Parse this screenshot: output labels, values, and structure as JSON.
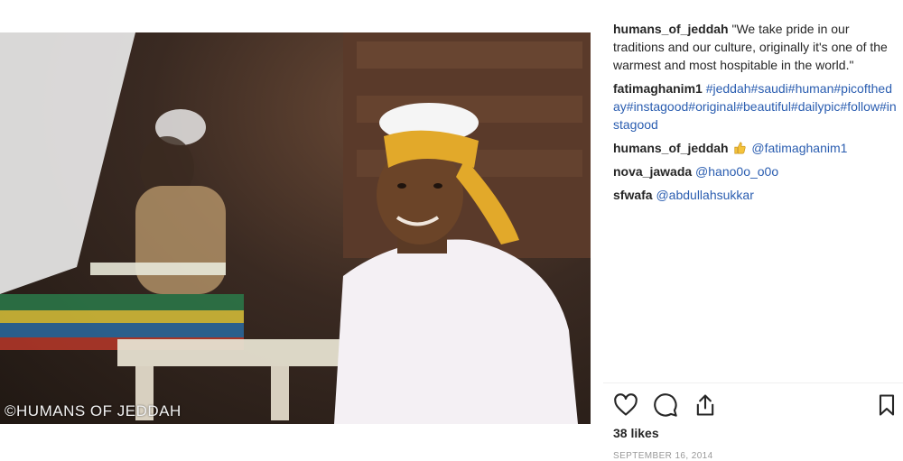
{
  "post": {
    "watermark": "©HUMANS OF JEDDAH",
    "caption": {
      "user": "humans_of_jeddah",
      "text": "\"We take pride in our traditions and our culture, originally it's one of the warmest and most hospitable in the world.\""
    },
    "comments": [
      {
        "user": "fatimaghanim1",
        "link": "#jeddah#saudi#human#picoftheday#instagood#original#beautiful#dailypic#follow#instagood"
      },
      {
        "user": "humans_of_jeddah",
        "emoji": "thumbs-up-emoji",
        "link": "@fatimaghanim1"
      },
      {
        "user": "nova_jawada",
        "link": "@hano0o_o0o"
      },
      {
        "user": "sfwafa",
        "link": "@abdullahsukkar"
      }
    ],
    "likes": "38 likes",
    "date": "SEPTEMBER 16, 2014"
  },
  "icons": {
    "like": "heart-icon",
    "comment": "comment-bubble-icon",
    "share": "share-icon",
    "save": "bookmark-icon"
  },
  "colors": {
    "link": "#2a5db0",
    "text": "#262626",
    "muted": "#999999"
  }
}
